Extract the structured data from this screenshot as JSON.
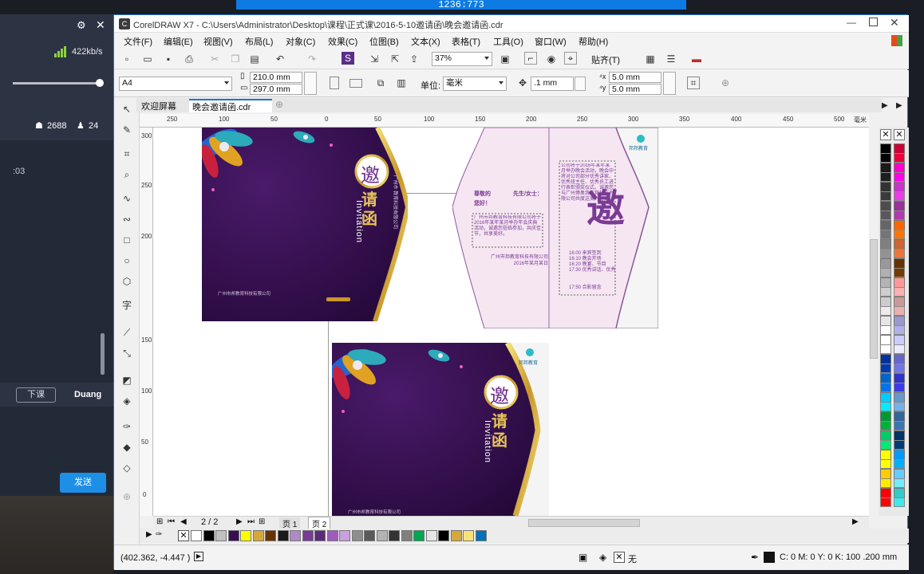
{
  "recording": {
    "size_text": "1236:773"
  },
  "stream_panel": {
    "settings_icon": "gear-icon",
    "close_icon": "close-icon",
    "speed": "422kb/s",
    "viewers": "2688",
    "likes": "24",
    "time_fragment": ":03",
    "leave_button": "下课",
    "user_name": "Duang",
    "send_button": "发送"
  },
  "window": {
    "title": "CorelDRAW X7 - C:\\Users\\Administrator\\Desktop\\课程\\正式课\\2016-5-10邀请函\\晚会邀请函.cdr",
    "menu": [
      "文件(F)",
      "编辑(E)",
      "视图(V)",
      "布局(L)",
      "对象(C)",
      "效果(C)",
      "位图(B)",
      "文本(X)",
      "表格(T)",
      "工具(O)",
      "窗口(W)",
      "帮助(H)"
    ]
  },
  "toolbar": {
    "zoom": "37%",
    "snap_label": "贴齐(T)"
  },
  "property_bar": {
    "page_size": "A4",
    "width": "210.0 mm",
    "height": "297.0 mm",
    "unit_label": "单位:",
    "unit_value": "毫米",
    "nudge": ".1 mm",
    "dup_x": "5.0 mm",
    "dup_y": "5.0 mm"
  },
  "tabs": [
    {
      "label": "欢迎屏幕"
    },
    {
      "label": "晚会邀请函.cdr"
    }
  ],
  "ruler": {
    "h_ticks": [
      "250",
      "100",
      "50",
      "0",
      "50",
      "100",
      "150",
      "200",
      "250",
      "300",
      "350",
      "400",
      "450",
      "500"
    ],
    "h_unit": "毫米",
    "v_ticks": [
      "300",
      "250",
      "200",
      "150",
      "100",
      "50",
      "0"
    ]
  },
  "design": {
    "invite_char": "邀",
    "title_chars": "请函",
    "invitation_word": "Invitation",
    "company_line": "广州市 教育科技有限公司",
    "footer_company": "广州市邦教育科技有限公司",
    "logo_text": "邦邦教育",
    "greeting_left": "尊敬的",
    "greeting_right": "先生/女士：",
    "greeting_tail": "您好！",
    "body_left": "广州市邦教育科技有限公司将于2016年某年某月举办年会庆典活动，诚邀您莅临参加，共庆佳节，共享美好。",
    "sign_company": "广州市邦教育科技有限公司",
    "sign_date": "2016年某月某日",
    "schedule": [
      "16:00 来宾签到",
      "16:10 晚会开场",
      "16:20 晚宴、节目",
      "17:30 优秀讲话、优秀",
      "17:50 合影留念"
    ],
    "body_right": "公司将于2016年某年某月举办晚会活动，晚会中将对公司部分优秀讲家、优秀班主任、优秀员工进行表彰颁奖仪式。诚邀您与广州博奥我教育科技有限公司共度这美好时刻。"
  },
  "page_nav": {
    "current": "2 / 2",
    "page1": "页 1",
    "page2": "页 2"
  },
  "status": {
    "coords": "(402.362, -4.447 )",
    "fill_label": "无",
    "outline_info": "C: 0 M: 0 Y: 0 K: 100  .200 mm"
  },
  "colors": {
    "accent": "#1f76c9",
    "design_purple": "#3a0f52",
    "design_gold": "#d4a93a",
    "invite_purple": "#7a3b95",
    "send_button": "#1e8fe6"
  },
  "palette_side": [
    "#000000",
    "#1a1a1a",
    "#333333",
    "#4d4d4d",
    "#666666",
    "#808080",
    "#999999",
    "#b3b3b3",
    "#cccccc",
    "#e6e6e6",
    "#ffffff",
    "#003399",
    "#0066cc",
    "#00ccff",
    "#009933",
    "#00cc66",
    "#ffff00",
    "#ffcc00",
    "#ff0000",
    "#cc0033",
    "#ff00cc",
    "#cc33cc",
    "#993399",
    "#ff6600",
    "#cc6633",
    "#663300",
    "#ff9999",
    "#cc9999",
    "#9999cc",
    "#ccccff",
    "#6666cc",
    "#3333cc",
    "#6699cc",
    "#336699",
    "#003366",
    "#0099ff",
    "#66ccff",
    "#33cccc"
  ],
  "palette_bottom": [
    "#ffffff",
    "#000000",
    "#c0c0c0",
    "#3a0f52",
    "#ffff00",
    "#d4a93a",
    "#663300",
    "#1a1a1a",
    "#b388c9",
    "#7a3b95",
    "#5c2a7a",
    "#a05bbf",
    "#c9a0dc",
    "#8e8e8e",
    "#5a5a5a",
    "#b3b3b3",
    "#333333",
    "#808080",
    "#00a651",
    "#e6e6e6",
    "#000000",
    "#d4a93a",
    "#f7e27a",
    "#0072bc"
  ]
}
